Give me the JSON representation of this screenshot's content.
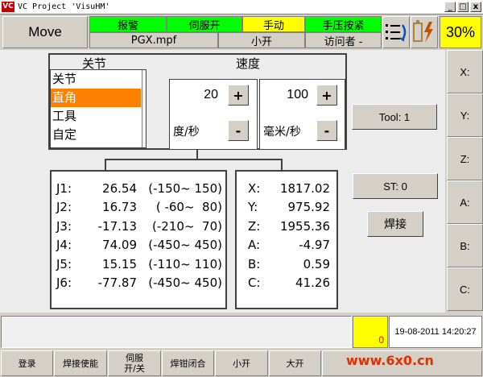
{
  "window": {
    "logo": "VC",
    "title": "VC Project 'VisuHM'",
    "min": "_",
    "max": "□",
    "close": "x"
  },
  "header": {
    "mode": "Move",
    "status": [
      "报警",
      "伺服开",
      "手动",
      "手压按紧"
    ],
    "file": "PGX.mpf",
    "speed_mode": "小开",
    "user": "访问者 -",
    "percent": "30%"
  },
  "joint_panel": {
    "title_joint": "关节",
    "title_speed": "速度",
    "list": [
      "关节",
      "直角",
      "工具",
      "自定"
    ],
    "selected_index": 1,
    "angular_speed": "20",
    "angular_unit": "度/秒",
    "linear_speed": "100",
    "linear_unit": "毫米/秒",
    "plus": "+",
    "minus": "-"
  },
  "tool_button": "Tool: 1",
  "st_button": "ST: 0",
  "weld_button": "焊接",
  "joints": [
    {
      "name": "J1:",
      "value": "26.54",
      "range": "(-150~ 150)"
    },
    {
      "name": "J2:",
      "value": "16.73",
      "range": "( -60~  80)"
    },
    {
      "name": "J3:",
      "value": "-17.13",
      "range": "(-210~  70)"
    },
    {
      "name": "J4:",
      "value": "74.09",
      "range": "(-450~ 450)"
    },
    {
      "name": "J5:",
      "value": "15.15",
      "range": "(-110~ 110)"
    },
    {
      "name": "J6:",
      "value": "-77.87",
      "range": "(-450~ 450)"
    }
  ],
  "cartesian": [
    {
      "name": "X:",
      "value": "1817.02"
    },
    {
      "name": "Y:",
      "value": "975.92"
    },
    {
      "name": "Z:",
      "value": "1955.36"
    },
    {
      "name": "A:",
      "value": "-4.97"
    },
    {
      "name": "B:",
      "value": "0.59"
    },
    {
      "name": "C:",
      "value": "41.26"
    }
  ],
  "side_buttons": [
    "X:",
    "Y:",
    "Z:",
    "A:",
    "B:",
    "C:"
  ],
  "footer": {
    "alarm_count": "0",
    "datetime": "19-08-2011 14:20:27",
    "keys": [
      "登录",
      "焊接使能",
      "伺服\n开/关",
      "焊钳闭合",
      "小开",
      "大开"
    ],
    "watermark": "www.6x0.cn"
  }
}
